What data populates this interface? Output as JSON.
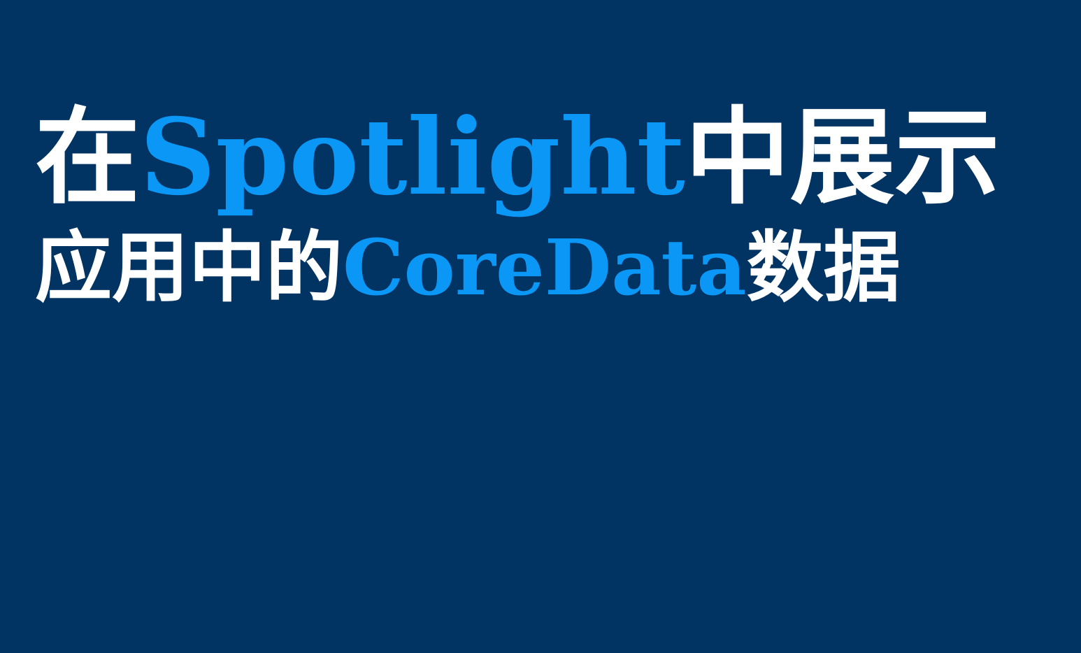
{
  "colors": {
    "background": "#013363",
    "text_primary": "#ffffff",
    "text_accent": "#0a97f5"
  },
  "title": {
    "line1": {
      "prefix": "在",
      "highlight": "Spotlight",
      "suffix": "中展示"
    },
    "line2": {
      "prefix": "应用中的",
      "highlight": "CoreData",
      "suffix": "数据"
    }
  }
}
